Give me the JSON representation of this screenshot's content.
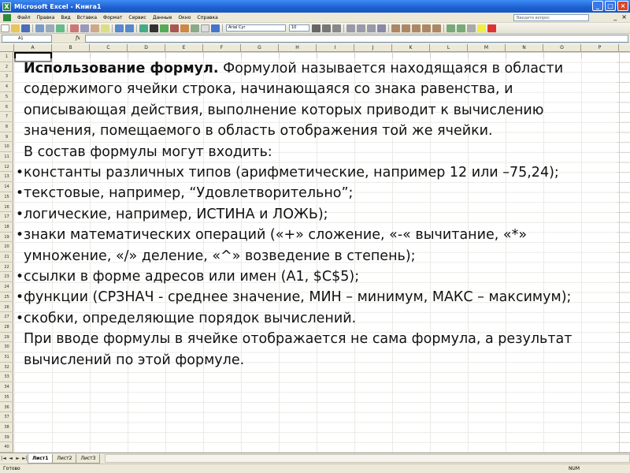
{
  "window": {
    "title": "Microsoft Excel - Книга1",
    "controls": [
      "_",
      "□",
      "×"
    ]
  },
  "menu": {
    "items": [
      "Файл",
      "Правка",
      "Вид",
      "Вставка",
      "Формат",
      "Сервис",
      "Данные",
      "Окно",
      "Справка"
    ],
    "help_placeholder": "Введите вопрос",
    "window_controls": [
      "_",
      "×"
    ]
  },
  "toolbar": {
    "font_name": "Arial Cyr",
    "font_size": "10"
  },
  "formula_bar": {
    "cell_ref": "A1",
    "fx": "fx",
    "value": ""
  },
  "grid": {
    "columns": [
      "A",
      "B",
      "C",
      "D",
      "E",
      "F",
      "G",
      "H",
      "I",
      "J",
      "K",
      "L",
      "M",
      "N",
      "O",
      "P"
    ],
    "rows": [
      "1",
      "2",
      "3",
      "4",
      "5",
      "6",
      "7",
      "8",
      "9",
      "10",
      "11",
      "12",
      "13",
      "14",
      "15",
      "16",
      "17",
      "18",
      "19",
      "20",
      "21",
      "22",
      "23",
      "24",
      "25",
      "26",
      "27",
      "28",
      "29",
      "30",
      "31",
      "32",
      "33",
      "34",
      "35",
      "36",
      "37",
      "38",
      "39",
      "40"
    ]
  },
  "content": {
    "intro_bold": "Использование формул.",
    "intro_rest": " Формулой называется находящаяся в области содержимого ячейки строка, начинающаяся со знака равенства, и описывающая действия, выполнение которых приводит к вычислению значения, помещаемого в область отображения той же ячейки.",
    "composition": "В состав формулы могут входить:",
    "bullets": [
      "константы различных типов  (арифметические, например 12 или –75,24);",
      "текстовые, например, “Удовлетворительно”;",
      "логические, например, ИСТИНА и ЛОЖЬ);",
      "знаки математических операций («+»  сложение, «-«  вычитание, «*» умножение, «/» деление, «^» возведение в степень);",
      "ссылки в форме адресов или имен (А1, $C$5);",
      "функции (СРЗНАЧ - среднее значение, МИН – минимум, МАКС – максимум);",
      "скобки, определяющие порядок вычислений."
    ],
    "bullet_symbol": "•",
    "closing": "При вводе формулы в ячейке отображается не сама формула, а результат вычислений по этой формуле."
  },
  "sheets": {
    "nav": [
      "|◄",
      "◄",
      "►",
      "►|"
    ],
    "tabs": [
      "Лист1",
      "Лист2",
      "Лист3"
    ],
    "active": "Лист1"
  },
  "status": {
    "text": "Готово",
    "num": "NUM"
  }
}
